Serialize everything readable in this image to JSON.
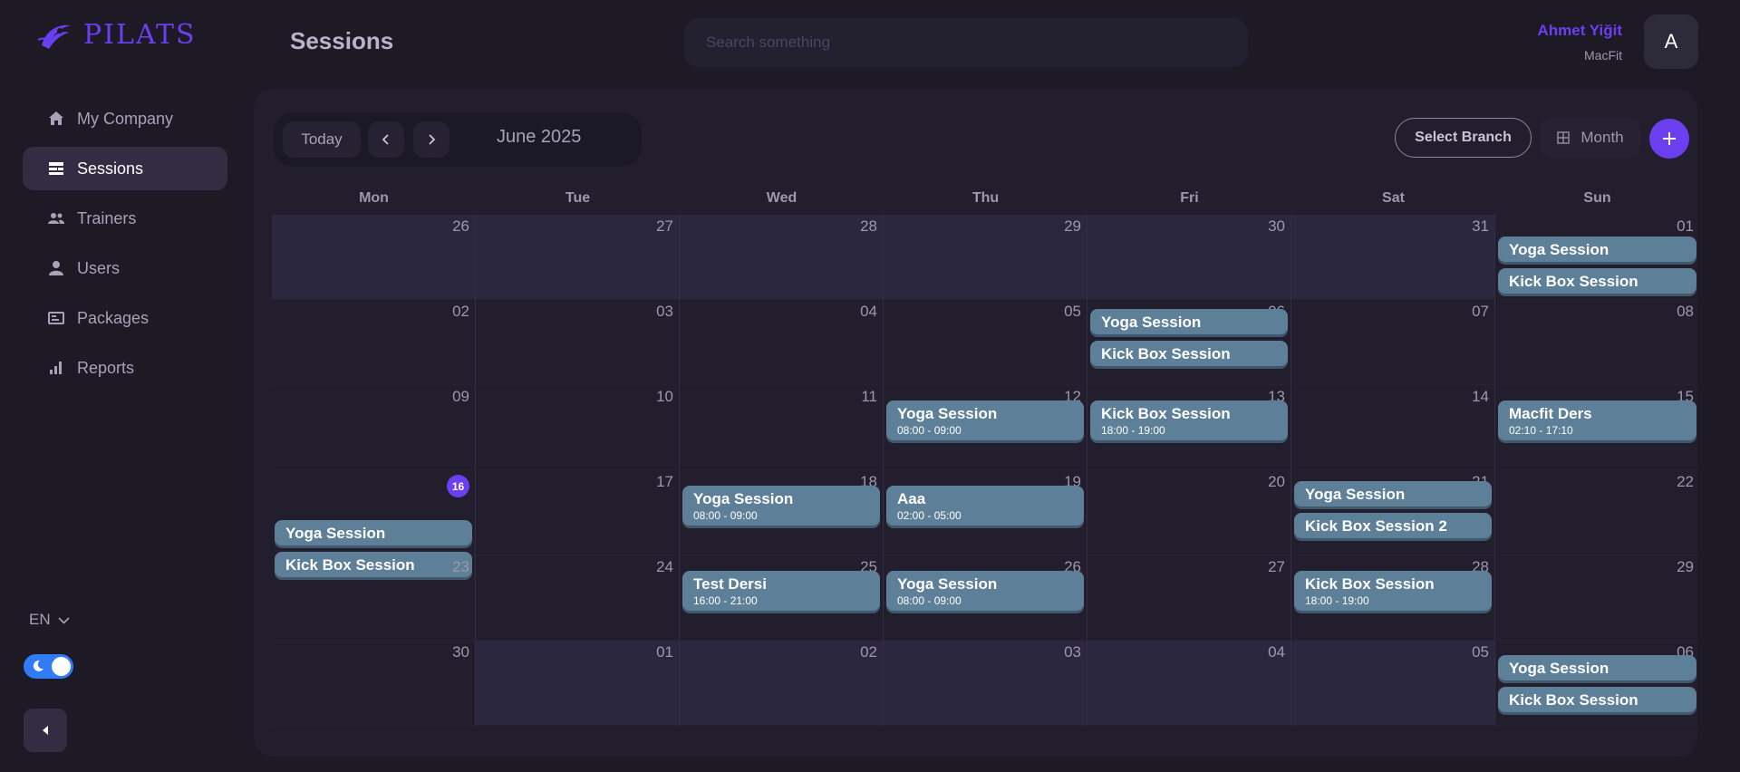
{
  "app": {
    "logo_text": "PILATS"
  },
  "sidebar": {
    "items": [
      {
        "label": "My Company",
        "icon": "home-icon",
        "active": false
      },
      {
        "label": "Sessions",
        "icon": "sessions-icon",
        "active": true
      },
      {
        "label": "Trainers",
        "icon": "trainers-icon",
        "active": false
      },
      {
        "label": "Users",
        "icon": "user-icon",
        "active": false
      },
      {
        "label": "Packages",
        "icon": "packages-icon",
        "active": false
      },
      {
        "label": "Reports",
        "icon": "reports-icon",
        "active": false
      }
    ],
    "language": "EN",
    "dark_mode": true
  },
  "header": {
    "title": "Sessions",
    "search_placeholder": "Search something",
    "user_name": "Ahmet Yiğit",
    "user_company": "MacFit",
    "avatar_initial": "A"
  },
  "calendar": {
    "today_label": "Today",
    "month_label": "June 2025",
    "select_branch_label": "Select Branch",
    "view_label": "Month",
    "weekdays": [
      "Mon",
      "Tue",
      "Wed",
      "Thu",
      "Fri",
      "Sat",
      "Sun"
    ],
    "weeks": [
      [
        {
          "day": "26",
          "other": true,
          "events": []
        },
        {
          "day": "27",
          "other": true,
          "events": []
        },
        {
          "day": "28",
          "other": true,
          "events": []
        },
        {
          "day": "29",
          "other": true,
          "events": []
        },
        {
          "day": "30",
          "other": true,
          "events": []
        },
        {
          "day": "31",
          "other": true,
          "events": []
        },
        {
          "day": "01",
          "other": false,
          "events": [
            {
              "title": "Yoga Session"
            },
            {
              "title": "Kick Box Session"
            }
          ]
        }
      ],
      [
        {
          "day": "02",
          "other": false,
          "events": []
        },
        {
          "day": "03",
          "other": false,
          "events": []
        },
        {
          "day": "04",
          "other": false,
          "events": []
        },
        {
          "day": "05",
          "other": false,
          "events": []
        },
        {
          "day": "06",
          "other": false,
          "events": [
            {
              "title": "Yoga Session"
            },
            {
              "title": "Kick Box Session"
            }
          ]
        },
        {
          "day": "07",
          "other": false,
          "events": []
        },
        {
          "day": "08",
          "other": false,
          "events": []
        }
      ],
      [
        {
          "day": "09",
          "other": false,
          "events": []
        },
        {
          "day": "10",
          "other": false,
          "events": []
        },
        {
          "day": "11",
          "other": false,
          "events": []
        },
        {
          "day": "12",
          "other": false,
          "events": [
            {
              "title": "Yoga Session",
              "time": "08:00 - 09:00"
            }
          ]
        },
        {
          "day": "13",
          "other": false,
          "events": [
            {
              "title": "Kick Box Session",
              "time": "18:00 - 19:00"
            }
          ]
        },
        {
          "day": "14",
          "other": false,
          "events": []
        },
        {
          "day": "15",
          "other": false,
          "events": [
            {
              "title": "Macfit Ders",
              "time": "02:10 - 17:10"
            }
          ]
        }
      ],
      [
        {
          "day": "16",
          "other": false,
          "today": true,
          "events": [
            {
              "title": "Yoga Session"
            },
            {
              "title": "Kick Box Session"
            }
          ]
        },
        {
          "day": "17",
          "other": false,
          "events": []
        },
        {
          "day": "18",
          "other": false,
          "events": [
            {
              "title": "Yoga Session",
              "time": "08:00 - 09:00"
            }
          ]
        },
        {
          "day": "19",
          "other": false,
          "events": [
            {
              "title": "Aaa",
              "time": "02:00 - 05:00"
            }
          ]
        },
        {
          "day": "20",
          "other": false,
          "events": []
        },
        {
          "day": "21",
          "other": false,
          "events": [
            {
              "title": "Yoga Session"
            },
            {
              "title": "Kick Box Session 2"
            }
          ]
        },
        {
          "day": "22",
          "other": false,
          "events": []
        }
      ],
      [
        {
          "day": "23",
          "other": false,
          "events": []
        },
        {
          "day": "24",
          "other": false,
          "events": []
        },
        {
          "day": "25",
          "other": false,
          "events": [
            {
              "title": "Test Dersi",
              "time": "16:00 - 21:00"
            }
          ]
        },
        {
          "day": "26",
          "other": false,
          "events": [
            {
              "title": "Yoga Session",
              "time": "08:00 - 09:00"
            }
          ]
        },
        {
          "day": "27",
          "other": false,
          "events": []
        },
        {
          "day": "28",
          "other": false,
          "events": [
            {
              "title": "Kick Box Session",
              "time": "18:00 - 19:00"
            }
          ]
        },
        {
          "day": "29",
          "other": false,
          "events": []
        }
      ],
      [
        {
          "day": "30",
          "other": false,
          "events": []
        },
        {
          "day": "01",
          "other": true,
          "events": []
        },
        {
          "day": "02",
          "other": true,
          "events": []
        },
        {
          "day": "03",
          "other": true,
          "events": []
        },
        {
          "day": "04",
          "other": true,
          "events": []
        },
        {
          "day": "05",
          "other": true,
          "events": []
        },
        {
          "day": "06",
          "other": false,
          "events": [
            {
              "title": "Yoga Session"
            },
            {
              "title": "Kick Box Session"
            }
          ]
        }
      ]
    ]
  },
  "colors": {
    "accent": "#6a3ff0",
    "event_bg": "#5d7f98",
    "background": "#1d1a26"
  }
}
